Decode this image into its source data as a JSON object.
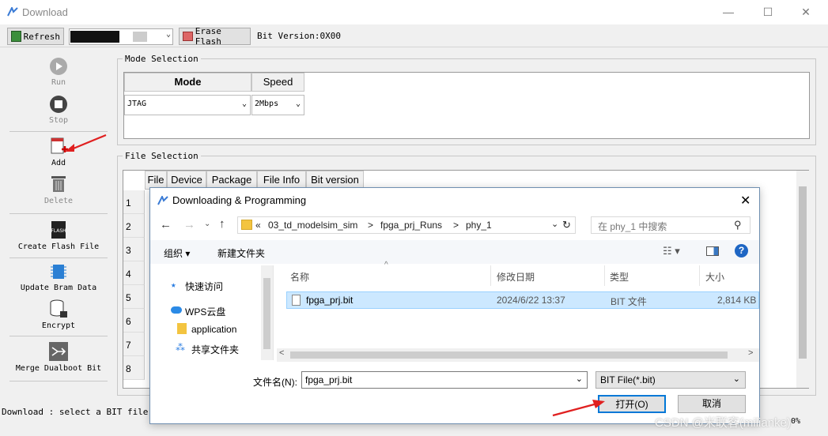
{
  "window": {
    "title": "Download",
    "min": "—",
    "max": "☐",
    "close": "✕"
  },
  "toolbar": {
    "refresh": "Refresh",
    "erase": "Erase Flash",
    "bit_version": "Bit Version:0X00"
  },
  "sidebar": {
    "run": "Run",
    "stop": "Stop",
    "add": "Add",
    "delete": "Delete",
    "create_flash": "Create Flash File",
    "update_bram": "Update Bram Data",
    "encrypt": "Encrypt",
    "merge": "Merge Dualboot Bit"
  },
  "mode_selection": {
    "title": "Mode Selection",
    "col_mode": "Mode",
    "col_speed": "Speed",
    "mode_value": "JTAG",
    "speed_value": "2Mbps"
  },
  "file_selection": {
    "title": "File Selection",
    "columns": [
      "File",
      "Device",
      "Package",
      "File Info",
      "Bit version"
    ],
    "rows": [
      "1",
      "2",
      "3",
      "4",
      "5",
      "6",
      "7",
      "8"
    ]
  },
  "status": {
    "text": "Download : select a BIT file in",
    "right": "0%"
  },
  "dialog": {
    "title": "Downloading & Programming",
    "breadcrumb": [
      "«",
      "03_td_modelsim_sim",
      ">",
      "fpga_prj_Runs",
      ">",
      "phy_1"
    ],
    "search_placeholder": "在 phy_1 中搜索",
    "organize": "组织 ▾",
    "new_folder": "新建文件夹",
    "nav": [
      "快速访问",
      "WPS云盘",
      "application",
      "共享文件夹"
    ],
    "columns": {
      "name": "名称",
      "date": "修改日期",
      "type": "类型",
      "size": "大小"
    },
    "file": {
      "name": "fpga_prj.bit",
      "date": "2024/6/22 13:37",
      "type": "BIT 文件",
      "size": "2,814 KB"
    },
    "filename_label": "文件名(N):",
    "filename_value": "fpga_prj.bit",
    "filetype": "BIT File(*.bit)",
    "open": "打开(O)",
    "cancel": "取消"
  },
  "watermark": "CSDN @米联客(milianke)",
  "colors": {
    "accent": "#0078d7",
    "annotation": "#e02020",
    "selected": "#cce8ff"
  }
}
